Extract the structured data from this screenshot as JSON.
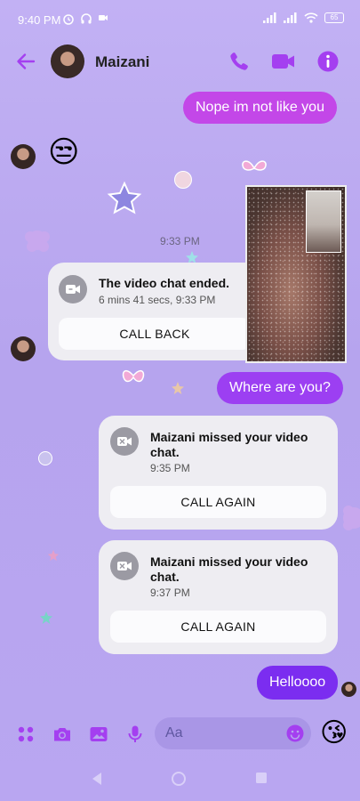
{
  "status_bar": {
    "time": "9:40 PM",
    "battery": "65"
  },
  "header": {
    "contact_name": "Maizani"
  },
  "messages": {
    "outgoing_1": "Nope im not like you",
    "incoming_emoji": "😒",
    "timestamp_1": "9:33 PM",
    "outgoing_2": "Where are you?",
    "outgoing_3": "Helloooo"
  },
  "call_cards": [
    {
      "title": "The video chat ended.",
      "subtitle": "6 mins 41 secs, 9:33 PM",
      "button": "CALL BACK"
    },
    {
      "title": "Maizani missed your video chat.",
      "subtitle": "9:35 PM",
      "button": "CALL AGAIN"
    },
    {
      "title": "Maizani missed your video chat.",
      "subtitle": "9:37 PM",
      "button": "CALL AGAIN"
    }
  ],
  "composer": {
    "placeholder": "Aa",
    "sticker": "😘"
  },
  "colors": {
    "accent": "#a33ff0",
    "bubble_out_1": "#c347e8",
    "bubble_out_2": "#9c3ff2",
    "bubble_out_3": "#7b2df0",
    "icon_purple": "#a43ff0"
  },
  "icons": {
    "back": "arrow-left-icon",
    "call": "phone-icon",
    "video": "video-camera-icon",
    "info": "info-icon",
    "apps": "grid-dots-icon",
    "camera": "camera-icon",
    "gallery": "image-icon",
    "mic": "microphone-icon",
    "emoji": "smiley-icon"
  }
}
